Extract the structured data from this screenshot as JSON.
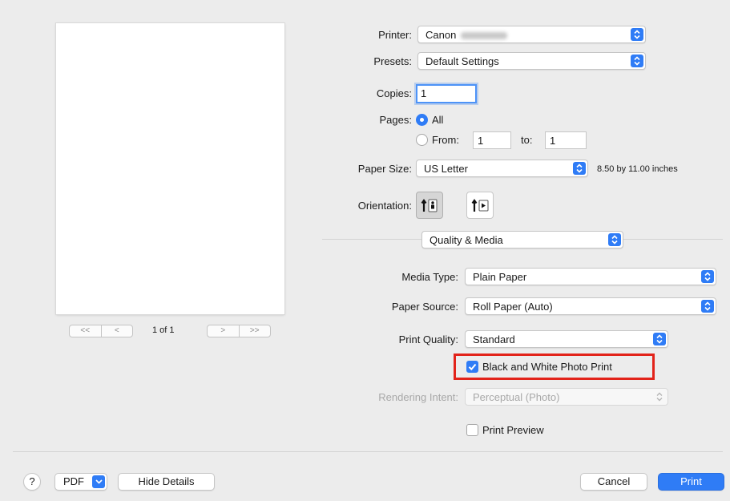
{
  "preview": {
    "page_indicator": "1 of 1",
    "first_glyph": "<<",
    "prev_glyph": "<",
    "next_glyph": ">",
    "last_glyph": ">>"
  },
  "printer": {
    "label": "Printer:",
    "value": "Canon"
  },
  "presets": {
    "label": "Presets:",
    "value": "Default Settings"
  },
  "copies": {
    "label": "Copies:",
    "value": "1"
  },
  "pages": {
    "label": "Pages:",
    "all_label": "All",
    "from_label": "From:",
    "from_value": "1",
    "to_label": "to:",
    "to_value": "1",
    "selected": "All"
  },
  "paper_size": {
    "label": "Paper Size:",
    "value": "US Letter",
    "dimensions": "8.50 by 11.00 inches"
  },
  "orientation": {
    "label": "Orientation:",
    "selected": "portrait"
  },
  "section": {
    "value": "Quality & Media"
  },
  "media_type": {
    "label": "Media Type:",
    "value": "Plain Paper"
  },
  "paper_source": {
    "label": "Paper Source:",
    "value": "Roll Paper (Auto)"
  },
  "print_quality": {
    "label": "Print Quality:",
    "value": "Standard"
  },
  "bw_photo": {
    "label": "Black and White Photo Print",
    "checked": true
  },
  "rendering_intent": {
    "label": "Rendering Intent:",
    "value": "Perceptual (Photo)",
    "enabled": false
  },
  "print_preview": {
    "label": "Print Preview",
    "checked": false
  },
  "footer": {
    "help": "?",
    "pdf": "PDF",
    "hide_details": "Hide Details",
    "cancel": "Cancel",
    "print": "Print"
  },
  "colors": {
    "accent": "#2f7cf6",
    "highlight": "#e2231a",
    "background": "#ececec"
  }
}
